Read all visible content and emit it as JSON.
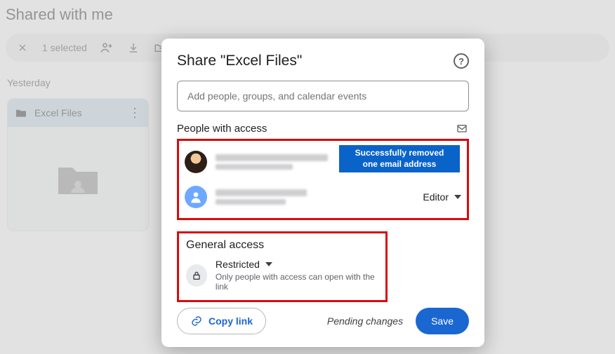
{
  "page": {
    "title": "Shared with me",
    "section_label": "Yesterday"
  },
  "selection_bar": {
    "count_label": "1 selected"
  },
  "file_card": {
    "name": "Excel Files"
  },
  "dialog": {
    "title": "Share \"Excel Files\"",
    "add_placeholder": "Add people, groups, and calendar events",
    "people_heading": "People with access",
    "toast_line1": "Successfully removed",
    "toast_line2": "one email address",
    "role_label": "Editor",
    "general_heading": "General access",
    "restricted_label": "Restricted",
    "restricted_desc": "Only people with access can open with the link",
    "copy_link_label": "Copy link",
    "pending_label": "Pending changes",
    "save_label": "Save"
  }
}
